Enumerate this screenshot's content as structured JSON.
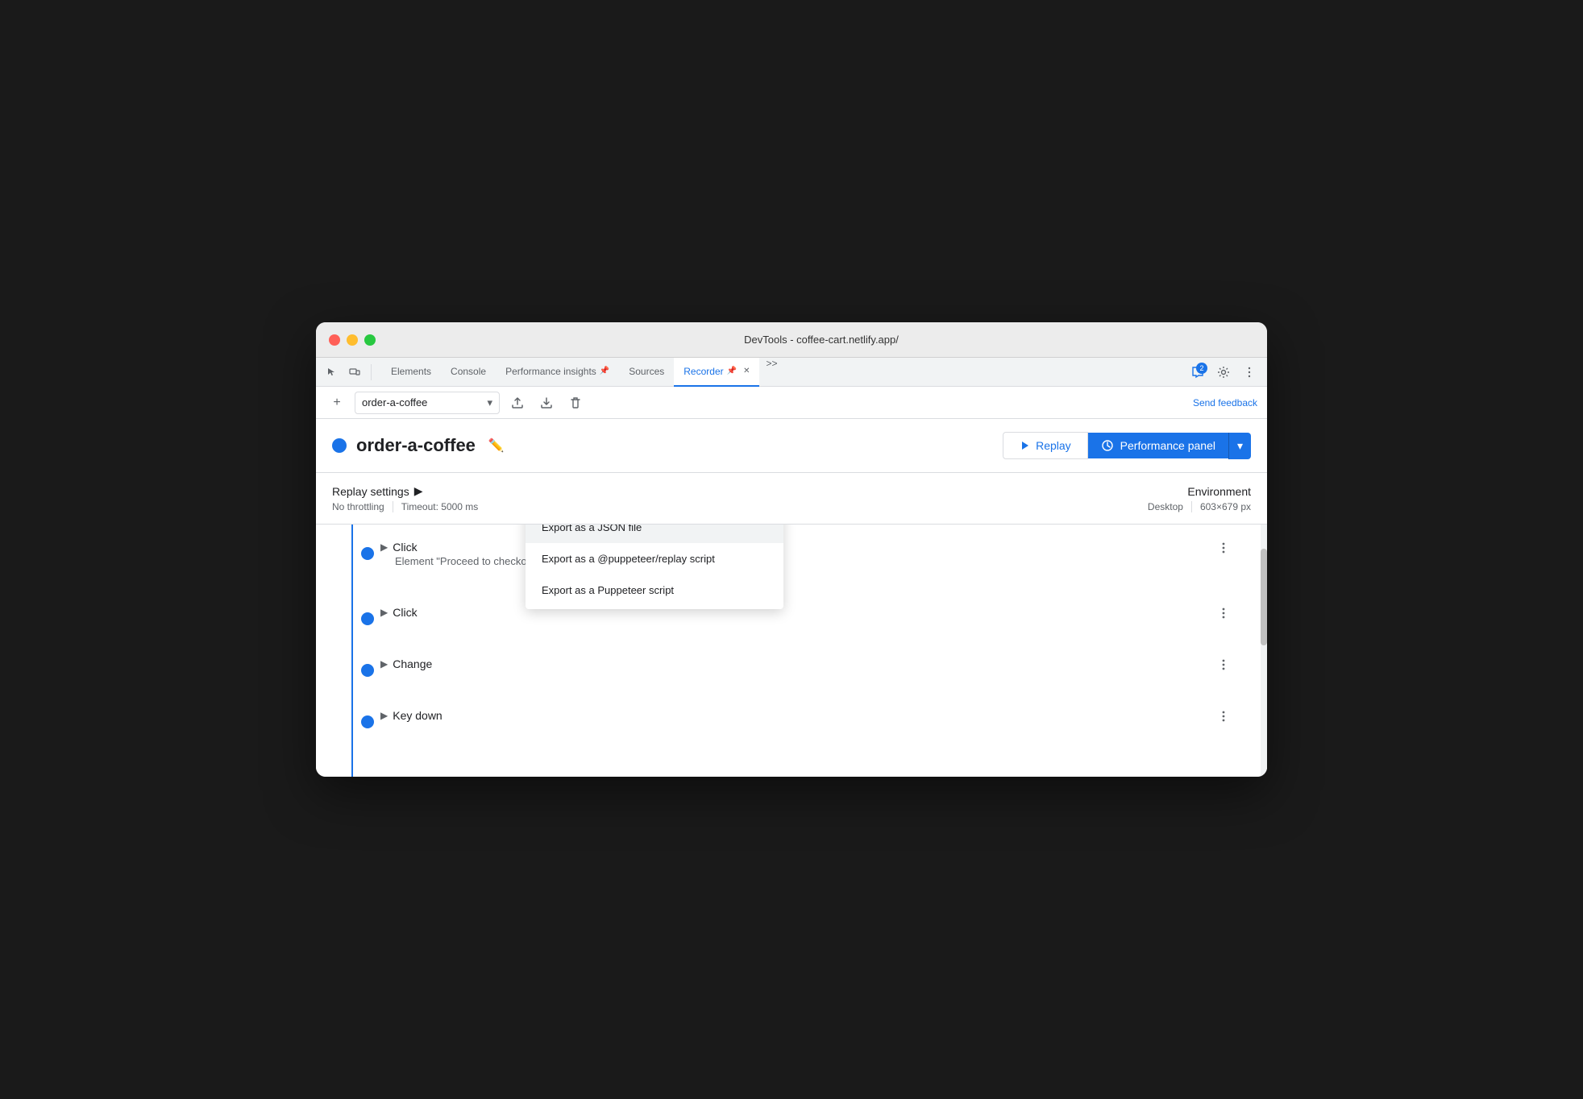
{
  "window": {
    "title": "DevTools - coffee-cart.netlify.app/"
  },
  "tabs": [
    {
      "id": "elements",
      "label": "Elements",
      "active": false,
      "pinned": false
    },
    {
      "id": "console",
      "label": "Console",
      "active": false,
      "pinned": false
    },
    {
      "id": "performance-insights",
      "label": "Performance insights",
      "active": false,
      "pinned": true
    },
    {
      "id": "sources",
      "label": "Sources",
      "active": false,
      "pinned": false
    },
    {
      "id": "recorder",
      "label": "Recorder",
      "active": true,
      "pinned": true
    }
  ],
  "tab_actions": {
    "chat_badge": "2",
    "more_label": ">>",
    "settings_label": "⚙"
  },
  "toolbar": {
    "add_label": "+",
    "recording_name": "order-a-coffee",
    "export_label": "⬆",
    "download_label": "⬇",
    "delete_label": "🗑",
    "send_feedback": "Send feedback"
  },
  "header": {
    "recording_name": "order-a-coffee",
    "replay_label": "Replay",
    "performance_panel_label": "Performance panel",
    "dropdown_arrow": "▾"
  },
  "settings": {
    "replay_settings_label": "Replay settings",
    "throttling": "No throttling",
    "timeout": "Timeout: 5000 ms",
    "environment_label": "Environment",
    "device": "Desktop",
    "resolution": "603×679 px"
  },
  "dropdown": {
    "items": [
      {
        "id": "export-json",
        "label": "Export as a JSON file",
        "highlighted": true
      },
      {
        "id": "export-puppeteer-replay",
        "label": "Export as a @puppeteer/replay script",
        "highlighted": false
      },
      {
        "id": "export-puppeteer",
        "label": "Export as a Puppeteer script",
        "highlighted": false
      }
    ]
  },
  "steps": [
    {
      "id": "step-1",
      "type": "Click",
      "subtitle": "Element \"Proceed to checkout\"",
      "has_subtitle": true
    },
    {
      "id": "step-2",
      "type": "Click",
      "subtitle": "",
      "has_subtitle": false
    },
    {
      "id": "step-3",
      "type": "Change",
      "subtitle": "",
      "has_subtitle": false
    },
    {
      "id": "step-4",
      "type": "Key down",
      "subtitle": "",
      "has_subtitle": false
    }
  ],
  "colors": {
    "blue": "#1a73e8",
    "text_primary": "#202124",
    "text_secondary": "#5f6368",
    "border": "#dadce0",
    "bg_light": "#f1f3f4"
  }
}
